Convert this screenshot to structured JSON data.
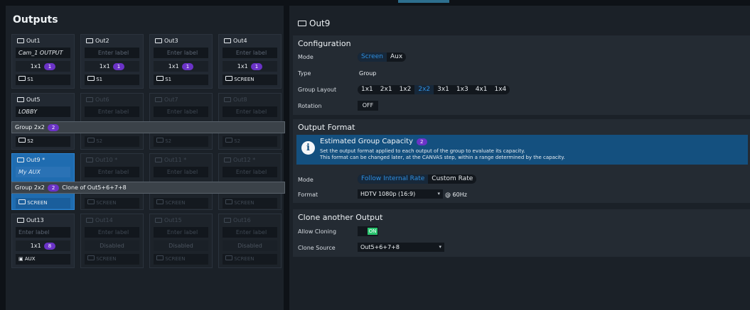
{
  "left": {
    "title": "Outputs",
    "tiles": [
      {
        "label": "Out1",
        "input": "Cam_1 OUTPUT",
        "res": "1x1",
        "badge": "1",
        "src": "S1"
      },
      {
        "label": "Out2",
        "input": "Enter label",
        "res": "1x1",
        "badge": "1",
        "src": "S1"
      },
      {
        "label": "Out3",
        "input": "Enter label",
        "res": "1x1",
        "badge": "1",
        "src": "S1"
      },
      {
        "label": "Out4",
        "input": "Enter label",
        "res": "1x1",
        "badge": "1",
        "src": "SCREEN"
      },
      {
        "label": "Out5",
        "input": "LOBBY",
        "src": "S2"
      },
      {
        "label": "Out6",
        "input": "Enter label",
        "src": "S2"
      },
      {
        "label": "Out7",
        "input": "Enter label",
        "src": "S2"
      },
      {
        "label": "Out8",
        "input": "Enter label",
        "src": "S2"
      },
      {
        "label": "Out9 *",
        "input": "My AUX",
        "src": "SCREEN"
      },
      {
        "label": "Out10 *",
        "input": "Enter label",
        "src": "SCREEN"
      },
      {
        "label": "Out11 *",
        "input": "Enter label",
        "src": "SCREEN"
      },
      {
        "label": "Out12 *",
        "input": "Enter label",
        "src": "SCREEN"
      },
      {
        "label": "Out13",
        "input": "Enter label",
        "res": "1x1",
        "badge": "8",
        "src": "AUX"
      },
      {
        "label": "Out14",
        "input": "Enter label",
        "res": "Disabled",
        "src": "SCREEN"
      },
      {
        "label": "Out15",
        "input": "Enter label",
        "res": "Disabled",
        "src": "SCREEN"
      },
      {
        "label": "Out16",
        "input": "Enter label",
        "res": "Disabled",
        "src": "SCREEN"
      }
    ],
    "group1": {
      "label": "Group 2x2",
      "badge": "2"
    },
    "group2": {
      "label": "Group 2x2",
      "badge": "2",
      "clone": "Clone of Out5+6+7+8"
    }
  },
  "right": {
    "title": "Out9",
    "config": {
      "title": "Configuration",
      "mode_label": "Mode",
      "mode_opts": [
        "Screen",
        "Aux"
      ],
      "type_label": "Type",
      "type_value": "Group",
      "layout_label": "Group Layout",
      "layout_opts": [
        "1x1",
        "2x1",
        "1x2",
        "2x2",
        "3x1",
        "1x3",
        "4x1",
        "1x4"
      ],
      "rotation_label": "Rotation",
      "rotation_value": "OFF"
    },
    "format": {
      "title": "Output Format",
      "info_title": "Estimated Group Capacity",
      "info_badge": "2",
      "info_line1": "Set the output format applied to each output of the group to evaluate its capacity.",
      "info_line2": "This format can be changed later, at the CANVAS step, within a range determined by the capacity.",
      "mode_label": "Mode",
      "mode_opts": [
        "Follow Internal Rate",
        "Custom Rate"
      ],
      "format_label": "Format",
      "format_value": "HDTV 1080p (16:9)",
      "rate": "@ 60Hz"
    },
    "clone": {
      "title": "Clone another Output",
      "allow_label": "Allow Cloning",
      "allow_value": "ON",
      "source_label": "Clone Source",
      "source_value": "Out5+6+7+8"
    }
  },
  "colors": {
    "accent": "#2f8fe0",
    "badge": "#6b33c7",
    "selected": "#1f6cb0",
    "on": "#29c46e"
  }
}
